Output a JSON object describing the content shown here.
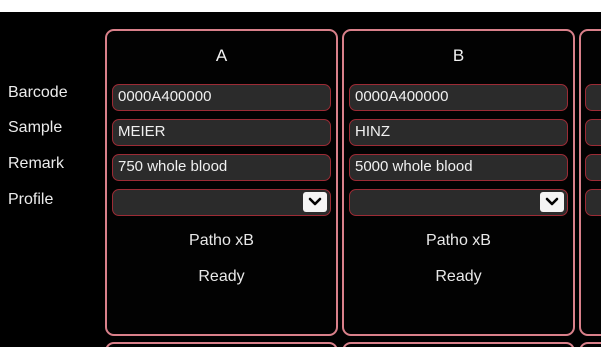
{
  "row_labels": {
    "barcode": "Barcode",
    "sample": "Sample",
    "remark": "Remark",
    "profile": "Profile"
  },
  "panels": [
    {
      "title": "A",
      "barcode": "0000A400000",
      "sample": "MEIER",
      "remark": "750 whole blood",
      "profile_value": "",
      "assay": "Patho xB",
      "status": "Ready"
    },
    {
      "title": "B",
      "barcode": "0000A400000",
      "sample": "HINZ",
      "remark": "5000 whole blood",
      "profile_value": "",
      "assay": "Patho xB",
      "status": "Ready"
    }
  ],
  "icons": {
    "dropdown": "chevron-down-icon"
  },
  "colors": {
    "background": "#000000",
    "panel_border": "#d9808a",
    "field_border": "#9c2b35",
    "field_fill": "#2b2b2b"
  }
}
